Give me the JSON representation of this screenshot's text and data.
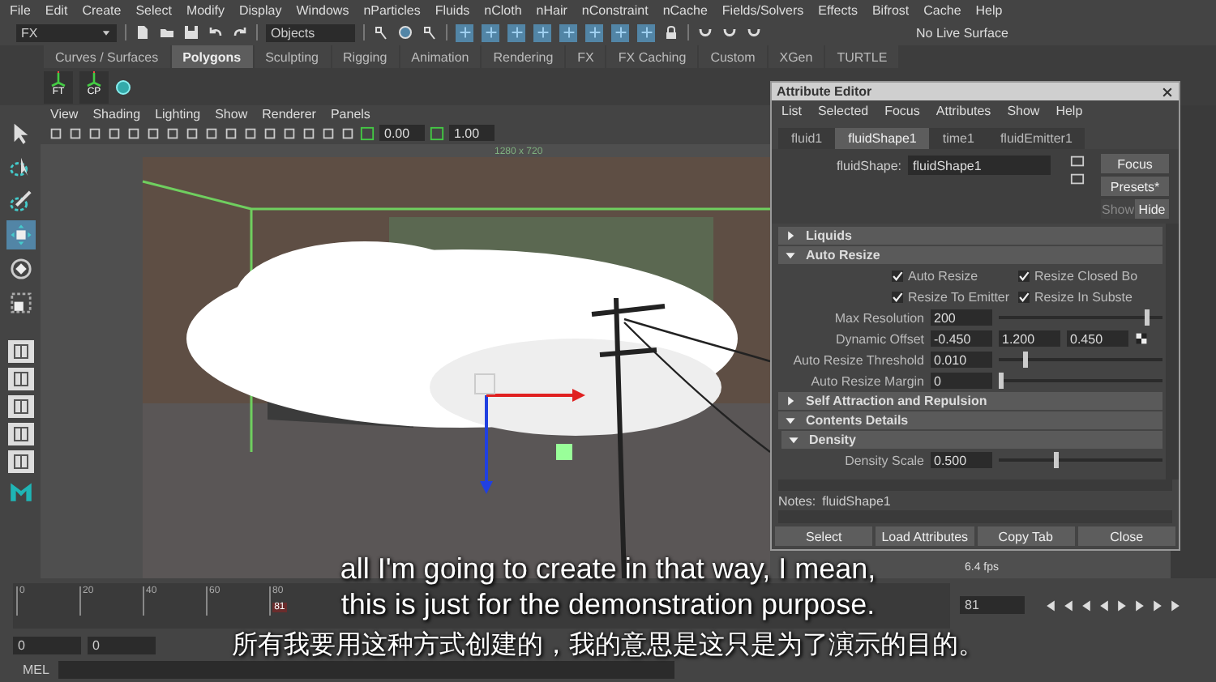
{
  "menu_bar": {
    "items": [
      "File",
      "Edit",
      "Create",
      "Select",
      "Modify",
      "Display",
      "Windows",
      "nParticles",
      "Fluids",
      "nCloth",
      "nHair",
      "nConstraint",
      "nCache",
      "Fields/Solvers",
      "Effects",
      "Bifrost",
      "Cache",
      "Help"
    ]
  },
  "status_line": {
    "mode": "FX",
    "selection_field": "Objects",
    "live_surface": "No Live Surface"
  },
  "shelf": {
    "tabs": [
      {
        "label": "Curves / Surfaces",
        "selected": false
      },
      {
        "label": "Polygons",
        "selected": true
      },
      {
        "label": "Sculpting",
        "selected": false
      },
      {
        "label": "Rigging",
        "selected": false
      },
      {
        "label": "Animation",
        "selected": false
      },
      {
        "label": "Rendering",
        "selected": false
      },
      {
        "label": "FX",
        "selected": false
      },
      {
        "label": "FX Caching",
        "selected": false
      },
      {
        "label": "Custom",
        "selected": false
      },
      {
        "label": "XGen",
        "selected": false
      },
      {
        "label": "TURTLE",
        "selected": false
      }
    ],
    "buttons": [
      "FT",
      "CP"
    ]
  },
  "toolbox": {
    "tools": [
      {
        "kind": "select",
        "selected": false
      },
      {
        "kind": "lasso",
        "selected": false
      },
      {
        "kind": "paint",
        "selected": false
      },
      {
        "kind": "move",
        "selected": true
      },
      {
        "kind": "rotate",
        "selected": false
      },
      {
        "kind": "scale",
        "selected": false
      }
    ]
  },
  "viewport": {
    "menu": [
      "View",
      "Shading",
      "Lighting",
      "Show",
      "Renderer",
      "Panels"
    ],
    "fields": [
      "0.00",
      "1.00"
    ],
    "resolution_label": "1280 x 720",
    "fps": "6.4 fps"
  },
  "attribute_editor": {
    "title": "Attribute Editor",
    "menu": [
      "List",
      "Selected",
      "Focus",
      "Attributes",
      "Show",
      "Help"
    ],
    "tabs": [
      {
        "label": "fluid1",
        "selected": false
      },
      {
        "label": "fluidShape1",
        "selected": true
      },
      {
        "label": "time1",
        "selected": false
      },
      {
        "label": "fluidEmitter1",
        "selected": false
      }
    ],
    "node_label": "fluidShape:",
    "node_value": "fluidShape1",
    "buttons": [
      "Focus",
      "Presets*"
    ],
    "visibility": [
      {
        "label": "Show",
        "selected": false
      },
      {
        "label": "Hide",
        "selected": true
      }
    ],
    "rows": [
      {
        "kind": "section",
        "label": "Liquids",
        "expanded": false
      },
      {
        "kind": "section",
        "label": "Auto Resize",
        "expanded": true
      },
      {
        "kind": "checks",
        "items": [
          {
            "label": "Auto Resize",
            "checked": true
          },
          {
            "label": "Resize Closed Bo",
            "checked": true
          }
        ]
      },
      {
        "kind": "checks",
        "items": [
          {
            "label": "Resize To Emitter",
            "checked": true
          },
          {
            "label": "Resize In Subste",
            "checked": true
          }
        ]
      },
      {
        "kind": "slider",
        "label": "Max Resolution",
        "value": "200",
        "level": 0.92
      },
      {
        "kind": "vector",
        "label": "Dynamic Offset",
        "values": [
          "-0.450",
          "1.200",
          "0.450"
        ]
      },
      {
        "kind": "slider",
        "label": "Auto Resize Threshold",
        "value": "0.010",
        "level": 0.15
      },
      {
        "kind": "slider",
        "label": "Auto Resize Margin",
        "value": "0",
        "level": 0.0
      },
      {
        "kind": "section",
        "label": "Self Attraction and Repulsion",
        "expanded": false
      },
      {
        "kind": "section",
        "label": "Contents Details",
        "expanded": true
      },
      {
        "kind": "subsection",
        "label": "Density",
        "expanded": true
      },
      {
        "kind": "slider",
        "label": "Density Scale",
        "value": "0.500",
        "level": 0.35
      }
    ],
    "notes_label": "Notes:",
    "notes_value": "fluidShape1",
    "footer_buttons": [
      "Select",
      "Load Attributes",
      "Copy Tab",
      "Close"
    ]
  },
  "time_slider": {
    "ticks": [
      "0",
      "20",
      "40",
      "60",
      "80"
    ],
    "current_frame": "81",
    "level": 0.277,
    "frame_field": "81"
  },
  "range_slider": {
    "fields": [
      "0",
      "0"
    ]
  },
  "command_line": {
    "label": "MEL"
  },
  "captions": [
    "all I'm going to create in that way, I mean,",
    "this is just for the demonstration purpose.",
    "所有我要用这种方式创建的，我的意思是这只是为了演示的目的。"
  ]
}
